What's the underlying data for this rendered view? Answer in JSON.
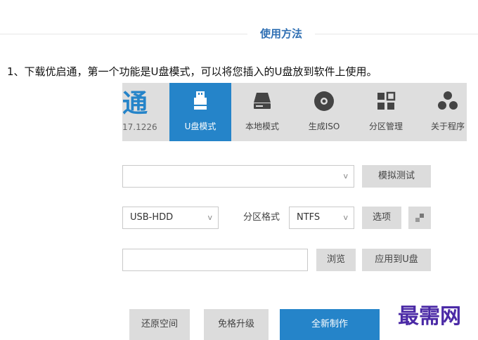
{
  "section": {
    "title": "使用方法"
  },
  "intro": {
    "text": "1、下载优启通，第一个功能是U盘模式，可以将您插入的U盘放到软件上使用。"
  },
  "app": {
    "logo_char": "通",
    "version": "17.1226",
    "tabs": [
      {
        "label": "U盘模式",
        "icon": "usb-drive-icon",
        "active": true
      },
      {
        "label": "本地模式",
        "icon": "hard-disk-icon",
        "active": false
      },
      {
        "label": "生成ISO",
        "icon": "disc-icon",
        "active": false
      },
      {
        "label": "分区管理",
        "icon": "partition-grid-icon",
        "active": false
      },
      {
        "label": "关于程序",
        "icon": "about-blocks-icon",
        "active": false
      }
    ],
    "device_select": {
      "value": "",
      "chevron": "v"
    },
    "simulate_button": "模拟测试",
    "mode_select": {
      "value": "USB-HDD",
      "chevron": "v"
    },
    "partition_format_label": "分区格式",
    "format_select": {
      "value": "NTFS",
      "chevron": "v"
    },
    "options_button": "选项",
    "path_input": {
      "value": ""
    },
    "browse_button": "浏览",
    "apply_button": "应用到U盘",
    "restore_button": "还原空间",
    "upgrade_button": "免格升级",
    "create_button": "全新制作",
    "accent_color": "#2584c9"
  },
  "watermark": {
    "text": "最需网"
  }
}
